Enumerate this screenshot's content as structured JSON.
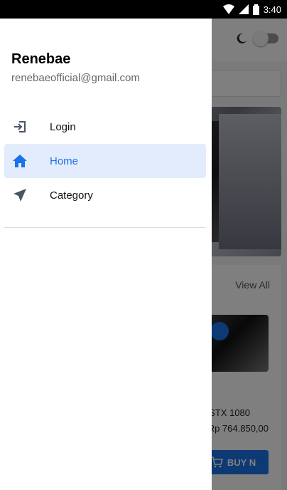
{
  "status_bar": {
    "time": "3:40",
    "icons": [
      "wifi-icon",
      "signal-icon",
      "battery-icon"
    ]
  },
  "drawer": {
    "user": {
      "name": "Renebae",
      "email": "renebaeofficial@gmail.com"
    },
    "items": [
      {
        "label": "Login",
        "icon": "login-icon",
        "active": false
      },
      {
        "label": "Home",
        "icon": "home-icon",
        "active": true
      },
      {
        "label": "Category",
        "icon": "send-icon",
        "active": false
      }
    ]
  },
  "background_app": {
    "section_link": "View All",
    "product": {
      "name": "STX 1080",
      "price": "Rp 764.850,00",
      "buy_label": "BUY N"
    }
  },
  "colors": {
    "accent": "#1a73e8",
    "active_bg": "#e3ecfc",
    "icon_gray": "#4a5566"
  }
}
